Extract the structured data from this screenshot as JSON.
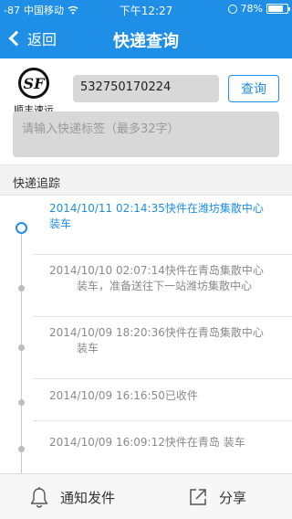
{
  "status_bar": {
    "signal": "-87",
    "carrier": "中国移动",
    "time": "下午12:27",
    "battery_text": "78%",
    "battery_level": 0.78
  },
  "nav": {
    "back_label": "返回",
    "title": "快递查询"
  },
  "query": {
    "company_name": "顺丰速运",
    "logo_letters": "SF",
    "tracking_number": "532750170224",
    "query_button": "查询",
    "label_placeholder": "请输入快递标签（最多32字）"
  },
  "section": {
    "title": "快递追踪"
  },
  "events": [
    {
      "line1": "2014/10/11 02:14:35快件在潍坊集散中心",
      "line2": "装车",
      "active": true
    },
    {
      "line1": "2014/10/10 02:07:14快件在青岛集散中心",
      "line2": "装车，准备送往下一站潍坊集散中心",
      "active": false
    },
    {
      "line1": "2014/10/09 18:20:36快件在青岛集散中心",
      "line2": "装车",
      "active": false
    },
    {
      "line1": "2014/10/09 16:16:50已收件",
      "line2": "",
      "active": false
    },
    {
      "line1": "2014/10/09 16:09:12快件在青岛  装车",
      "line2": "",
      "active": false
    }
  ],
  "toolbar": {
    "notify_label": "通知发件",
    "share_label": "分享"
  },
  "colors": {
    "accent": "#1e8ee6",
    "inactive_text": "#8a8a8a"
  },
  "icons": {
    "back": "chevron-left-icon",
    "notify": "bell-icon",
    "share": "share-icon",
    "wifi": "wifi-icon",
    "battery": "battery-icon"
  }
}
